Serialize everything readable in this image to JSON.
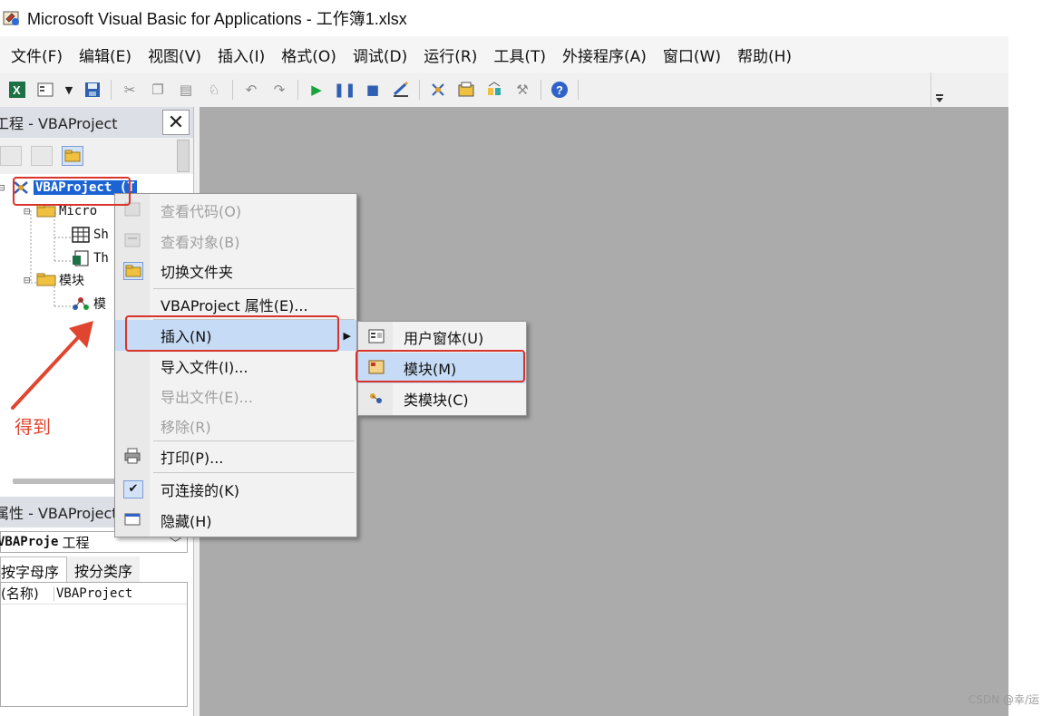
{
  "window": {
    "title": "Microsoft Visual Basic for Applications - 工作簿1.xlsx"
  },
  "menubar": {
    "items": [
      "文件(F)",
      "编辑(E)",
      "视图(V)",
      "插入(I)",
      "格式(O)",
      "调试(D)",
      "运行(R)",
      "工具(T)",
      "外接程序(A)",
      "窗口(W)",
      "帮助(H)"
    ]
  },
  "project_panel": {
    "title": "工程 - VBAProject",
    "close": "✕",
    "tree": {
      "root": "VBAProject (T",
      "folder_objects": "Micro",
      "sheet1": "Sh",
      "thisworkbook": "Th",
      "folder_modules": "模块",
      "module1": "模"
    }
  },
  "properties_panel": {
    "title": "属性 - VBAProject",
    "object_select": {
      "name": "VBAProje",
      "type": "工程"
    },
    "tabs": [
      "按字母序",
      "按分类序"
    ],
    "rows": [
      {
        "name": "(名称)",
        "value": "VBAProject"
      }
    ]
  },
  "context_menu": {
    "items": [
      {
        "label": "查看代码(O)",
        "enabled": false
      },
      {
        "label": "查看对象(B)",
        "enabled": false
      },
      {
        "label": "切换文件夹",
        "enabled": true
      },
      {
        "label": "VBAProject 属性(E)...",
        "enabled": true
      },
      {
        "label": "插入(N)",
        "enabled": true,
        "highlighted": true
      },
      {
        "label": "导入文件(I)...",
        "enabled": true
      },
      {
        "label": "导出文件(E)...",
        "enabled": false
      },
      {
        "label": "移除(R)",
        "enabled": false
      },
      {
        "label": "打印(P)...",
        "enabled": true
      },
      {
        "label": "可连接的(K)",
        "enabled": true,
        "checked": true
      },
      {
        "label": "隐藏(H)",
        "enabled": true
      }
    ]
  },
  "submenu": {
    "items": [
      {
        "label": "用户窗体(U)"
      },
      {
        "label": "模块(M)",
        "highlighted": true
      },
      {
        "label": "类模块(C)"
      }
    ]
  },
  "annotation": {
    "text": "得到",
    "color": "#e0462f"
  },
  "watermark": "CSDN @幸/运",
  "colors": {
    "workspace": "#ababab",
    "selection": "#1c64d4",
    "menu_highlight": "#c6dbf5",
    "annotation_red": "#d9342b"
  }
}
